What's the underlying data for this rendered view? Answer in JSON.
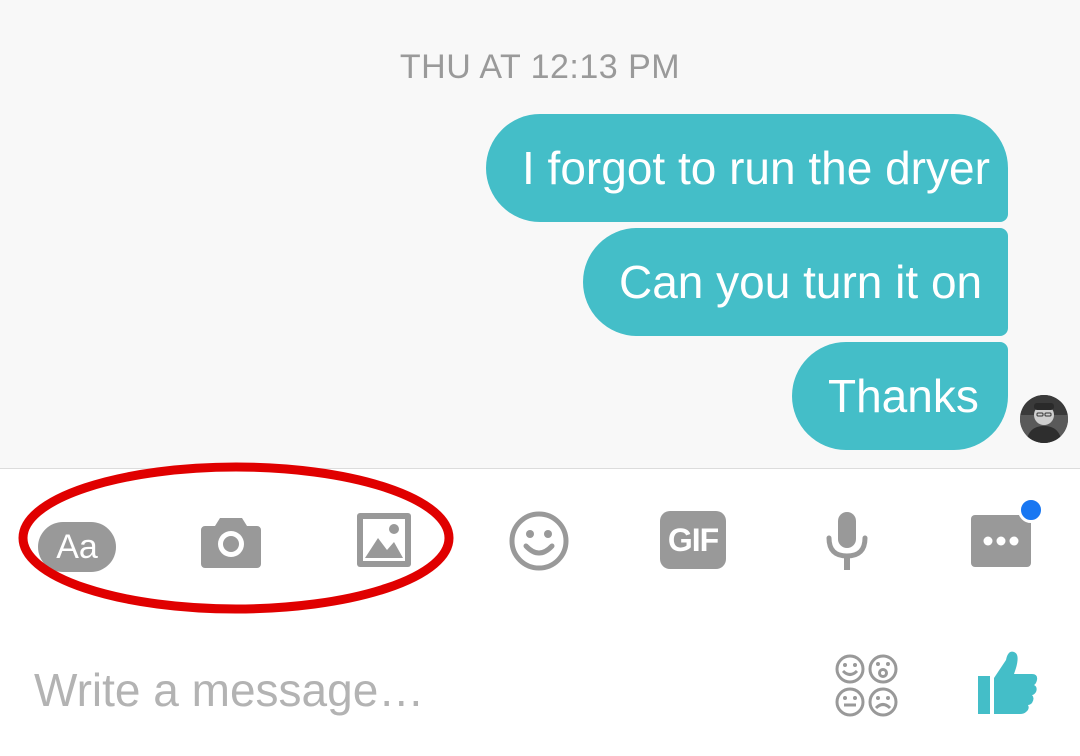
{
  "conversation": {
    "timestamp": "THU AT 12:13 PM",
    "messages": [
      {
        "text": "I forgot to run the dryer"
      },
      {
        "text": "Can you turn it on"
      },
      {
        "text": "Thanks"
      }
    ]
  },
  "toolbar": {
    "text_label": "Aa",
    "gif_label": "GIF",
    "icons": [
      "text-icon",
      "camera-icon",
      "gallery-icon",
      "emoji-icon",
      "gif-icon",
      "microphone-icon",
      "more-icon"
    ]
  },
  "composer": {
    "placeholder": "Write a message…",
    "icons": [
      "reactions-icon",
      "thumbs-up-icon"
    ]
  },
  "colors": {
    "bubble": "#44bec8",
    "icon": "#999999",
    "badge": "#1877f2",
    "highlight": "#e00000"
  }
}
